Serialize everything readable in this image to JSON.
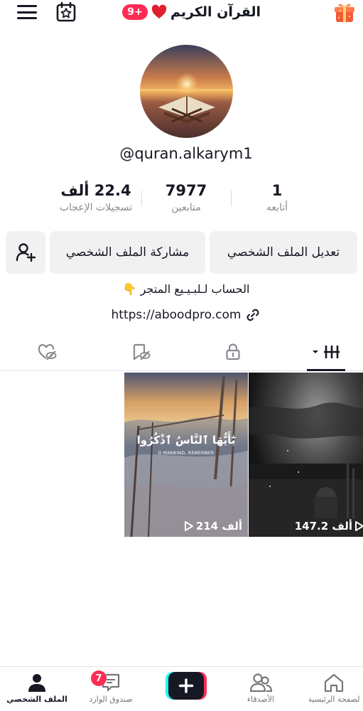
{
  "header": {
    "title": "القرآن الكريم",
    "notification_badge": "9+"
  },
  "profile": {
    "username": "@quran.alkarym1",
    "stats": {
      "likes": {
        "value": "22.4 ألف",
        "label": "تسجيلات الإعجاب"
      },
      "followers": {
        "value": "7977",
        "label": "متابعين"
      },
      "following": {
        "value": "1",
        "label": "أتابعه"
      }
    },
    "edit_button": "تعديل الملف الشخصي",
    "share_button": "مشاركة الملف الشخصي",
    "bio": "الحساب لـلبـيـيع المتجر 👇",
    "link": "https://aboodpro.com"
  },
  "videos": [
    {
      "views": "214 ألف",
      "caption": "يَٰٓأَيُّهَا ٱلنَّاسُ ٱذْكُرُوا",
      "subcaption": "O MANKIND, REMEMBER"
    },
    {
      "views": "147.2 ألف"
    }
  ],
  "bottom_nav": {
    "home": "لصفحة الرئيسية",
    "friends": "الأصدقاء",
    "inbox": "صندوق الوارد",
    "inbox_badge": "7",
    "profile": "الملف الشخصي"
  },
  "colors": {
    "accent": "#fe2c55",
    "text": "#161823",
    "muted": "#8a8b91",
    "button_bg": "#f1f1f2"
  }
}
